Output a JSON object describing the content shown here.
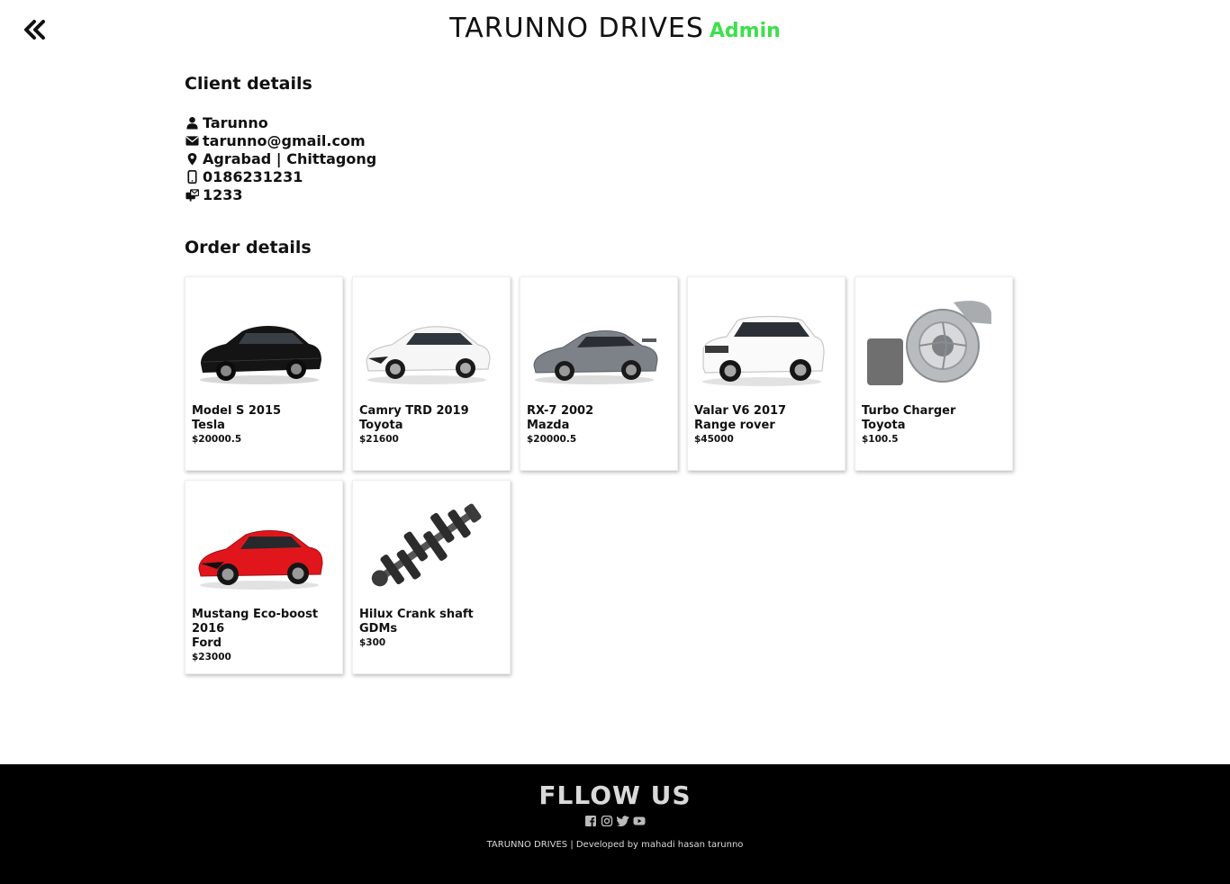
{
  "header": {
    "back_icon": "double-chevron-left-icon",
    "brand": "TARUNNO DRIVES",
    "role": "Admin",
    "role_color": "#3de04b"
  },
  "client": {
    "title": "Client details",
    "name": "Tarunno",
    "email": "tarunno@gmail.com",
    "address": "Agrabad | Chittagong",
    "phone": "0186231231",
    "postcode": "1233"
  },
  "orders": {
    "title": "Order details",
    "items": [
      {
        "name": "Model S 2015",
        "make": "Tesla",
        "price": "$20000.5",
        "image": "black-sedan"
      },
      {
        "name": "Camry TRD 2019",
        "make": "Toyota",
        "price": "$21600",
        "image": "white-sedan"
      },
      {
        "name": "RX-7 2002",
        "make": "Mazda",
        "price": "$20000.5",
        "image": "grey-coupe"
      },
      {
        "name": "Valar V6 2017",
        "make": "Range rover",
        "price": "$45000",
        "image": "white-suv"
      },
      {
        "name": "Turbo Charger",
        "make": "Toyota",
        "price": "$100.5",
        "image": "turbocharger"
      },
      {
        "name": "Mustang Eco-boost 2016",
        "make": "Ford",
        "price": "$23000",
        "image": "red-coupe"
      },
      {
        "name": "Hilux Crank shaft",
        "make": "GDMs",
        "price": "$300",
        "image": "crankshaft"
      }
    ]
  },
  "footer": {
    "title": "FLLOW US",
    "socials": [
      "facebook-icon",
      "instagram-icon",
      "twitter-icon",
      "youtube-icon"
    ],
    "credit": "TARUNNO DRIVES | Developed by mahadi hasan tarunno"
  }
}
